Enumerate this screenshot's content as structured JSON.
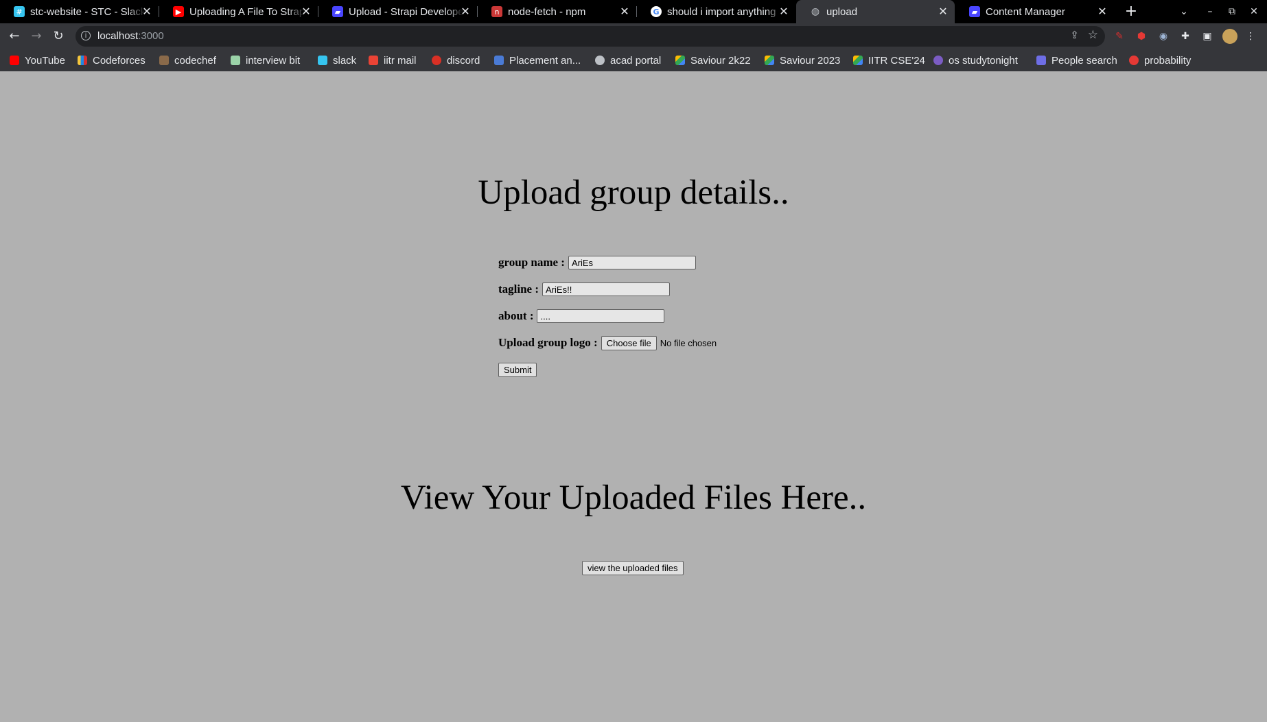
{
  "browser": {
    "tabs": [
      {
        "title": "stc-website - STC - Slack",
        "favicon": "slack-icon",
        "color": "#36c5f0"
      },
      {
        "title": "Uploading A File To Strapi",
        "favicon": "youtube-icon",
        "color": "#ff0000"
      },
      {
        "title": "Upload - Strapi Developer",
        "favicon": "strapi-icon",
        "color": "#4945ff"
      },
      {
        "title": "node-fetch - npm",
        "favicon": "npm-icon",
        "color": "#cb3837"
      },
      {
        "title": "should i import anything",
        "favicon": "google-icon",
        "color": "#4285f4"
      },
      {
        "title": "upload",
        "favicon": "globe-icon",
        "color": "#bdc1c6"
      },
      {
        "title": "Content Manager",
        "favicon": "strapi-icon",
        "color": "#4945ff"
      }
    ],
    "close_glyph": "✕",
    "new_tab_glyph": "+",
    "address": {
      "host": "localhost",
      "port": ":3000"
    },
    "bookmarks": [
      {
        "label": "YouTube",
        "icon": "youtube-icon",
        "color": "#ff0000"
      },
      {
        "label": "Codeforces",
        "icon": "codeforces-icon",
        "color": "#f5c63c"
      },
      {
        "label": "codechef",
        "icon": "codechef-icon",
        "color": "#8a6a4a"
      },
      {
        "label": "interview bit",
        "icon": "interviewbit-icon",
        "color": "#9bd3a8"
      },
      {
        "label": "slack",
        "icon": "slack-icon",
        "color": "#36c5f0"
      },
      {
        "label": "iitr mail",
        "icon": "gmail-icon",
        "color": "#ea4335"
      },
      {
        "label": "discord",
        "icon": "calendar-icon",
        "color": "#d93025"
      },
      {
        "label": "Placement an...",
        "icon": "docs-icon",
        "color": "#4a7bd6"
      },
      {
        "label": "acad portal",
        "icon": "globe-icon",
        "color": "#bdc1c6"
      },
      {
        "label": "Saviour 2k22",
        "icon": "drive-icon",
        "color": "#fbbc04"
      },
      {
        "label": "Saviour 2023",
        "icon": "drive-icon",
        "color": "#fbbc04"
      },
      {
        "label": "IITR CSE'24",
        "icon": "drive-icon",
        "color": "#fbbc04"
      },
      {
        "label": "os studytonight",
        "icon": "studytonight-icon",
        "color": "#7b5cc4"
      },
      {
        "label": "People search",
        "icon": "people-icon",
        "color": "#6e6ee6"
      },
      {
        "label": "probability",
        "icon": "star-icon",
        "color": "#e53935"
      }
    ]
  },
  "page": {
    "upload_heading": "Upload group details..",
    "group_name_label": "group name :",
    "group_name_value": "AriEs",
    "tagline_label": "tagline :",
    "tagline_value": "AriEs!!",
    "about_label": "about :",
    "about_value": "....",
    "logo_label": "Upload group logo :",
    "choose_file_label": "Choose file",
    "no_file_text": "No file chosen",
    "submit_label": "Submit",
    "view_heading": "View Your Uploaded Files Here..",
    "view_button_label": "view the uploaded files"
  }
}
